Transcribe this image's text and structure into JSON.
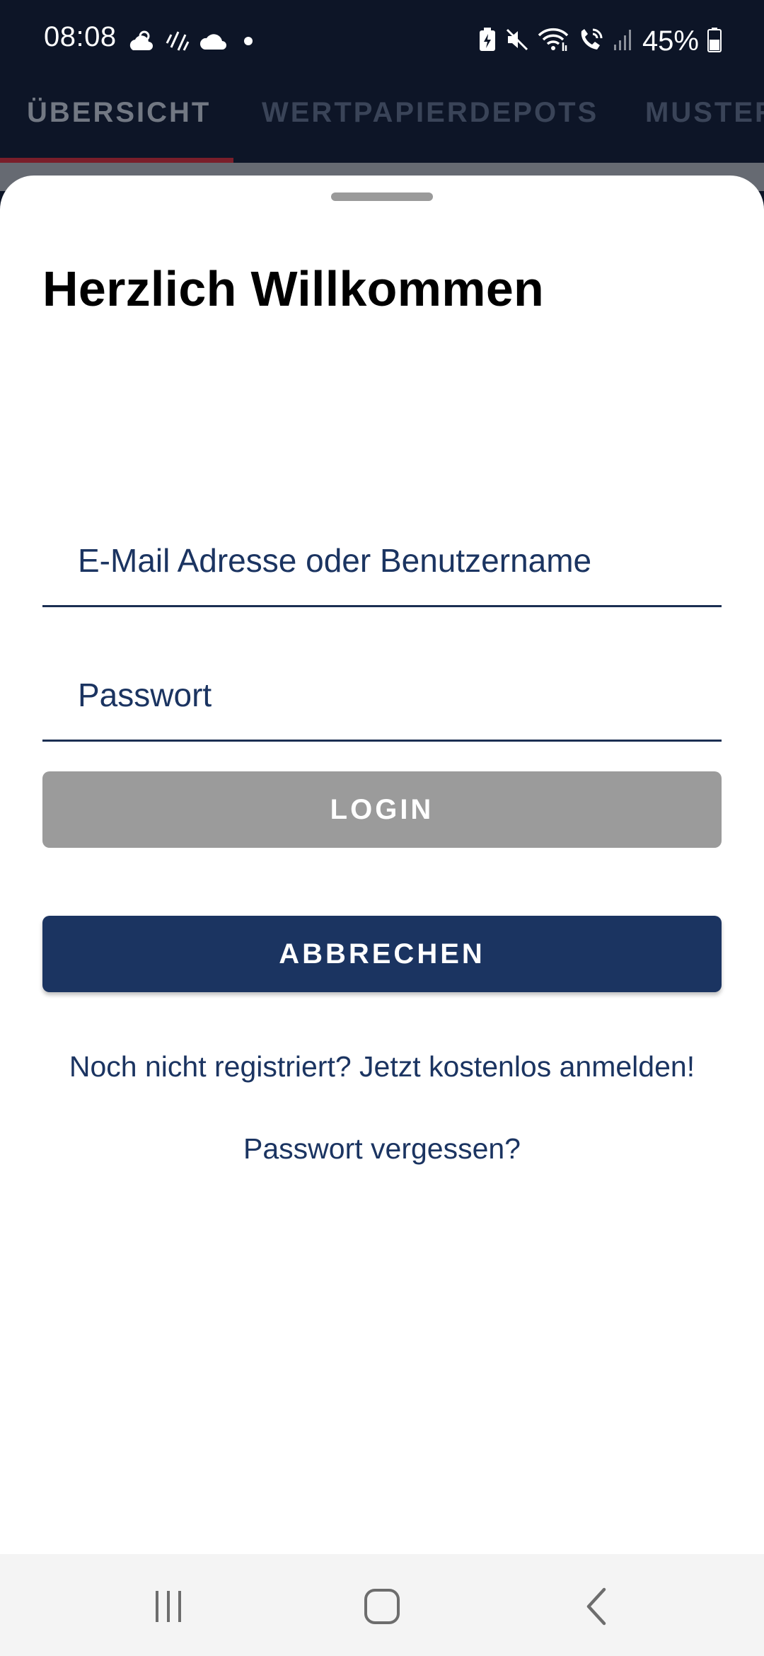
{
  "status_bar": {
    "time": "08:08",
    "battery_percent": "45%",
    "left_icons": [
      "weather-sun-cloud-icon",
      "weather-rain-icon",
      "cloud-icon",
      "dot-icon"
    ],
    "right_icons": [
      "battery-saver-icon",
      "mute-icon",
      "wifi-icon",
      "wifi-calling-icon",
      "signal-icon",
      "battery-icon"
    ]
  },
  "tabs": [
    {
      "label": "ÜBERSICHT",
      "active": true
    },
    {
      "label": "WERTPAPIERDEPOTS",
      "active": false
    },
    {
      "label": "MUSTER",
      "active": false
    }
  ],
  "login_sheet": {
    "title": "Herzlich Willkommen",
    "username_placeholder": "E-Mail Adresse oder Benutzername",
    "username_value": "",
    "password_placeholder": "Passwort",
    "password_value": "",
    "login_label": "LOGIN",
    "cancel_label": "ABBRECHEN",
    "register_link": "Noch nicht registriert? Jetzt kostenlos anmelden!",
    "forgot_link": "Passwort vergessen?"
  },
  "nav_bar": {
    "icons": [
      "recent-apps-icon",
      "home-icon",
      "back-icon"
    ]
  },
  "colors": {
    "status_bg": "#0d1527",
    "primary": "#1b3461",
    "disabled_button": "#9b9b9b",
    "tab_indicator": "#7a1e2a"
  }
}
